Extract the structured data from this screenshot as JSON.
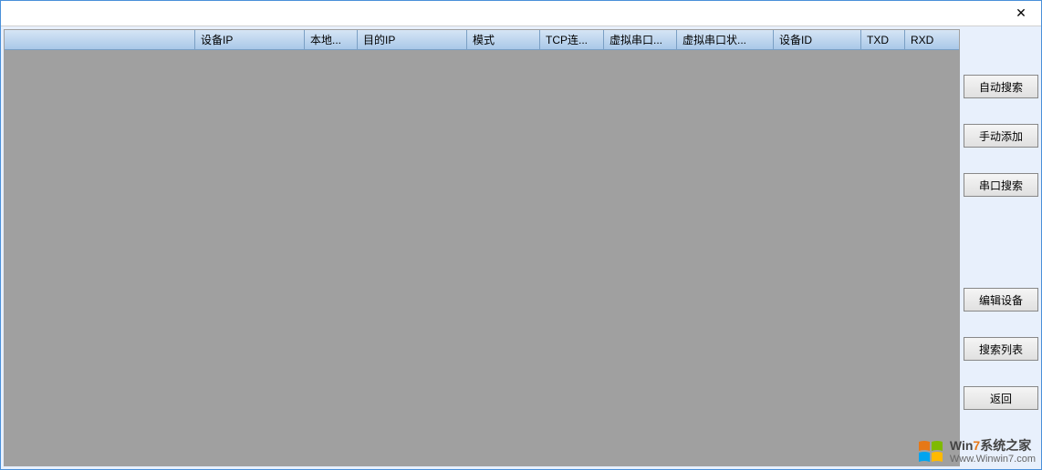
{
  "titlebar": {
    "close_symbol": "✕"
  },
  "table": {
    "columns": [
      "",
      "设备IP",
      "本地...",
      "目的IP",
      "模式",
      "TCP连...",
      "虚拟串口...",
      "虚拟串口状...",
      "设备ID",
      "TXD",
      "RXD"
    ]
  },
  "buttons": {
    "auto_search": "自动搜索",
    "manual_add": "手动添加",
    "serial_search": "串口搜索",
    "edit_device": "编辑设备",
    "search_list": "搜索列表",
    "back": "返回"
  },
  "watermark": {
    "brand_prefix": "Win",
    "brand_num": "7",
    "brand_cn": "系统之家",
    "url": "Www.Winwin7.com"
  }
}
